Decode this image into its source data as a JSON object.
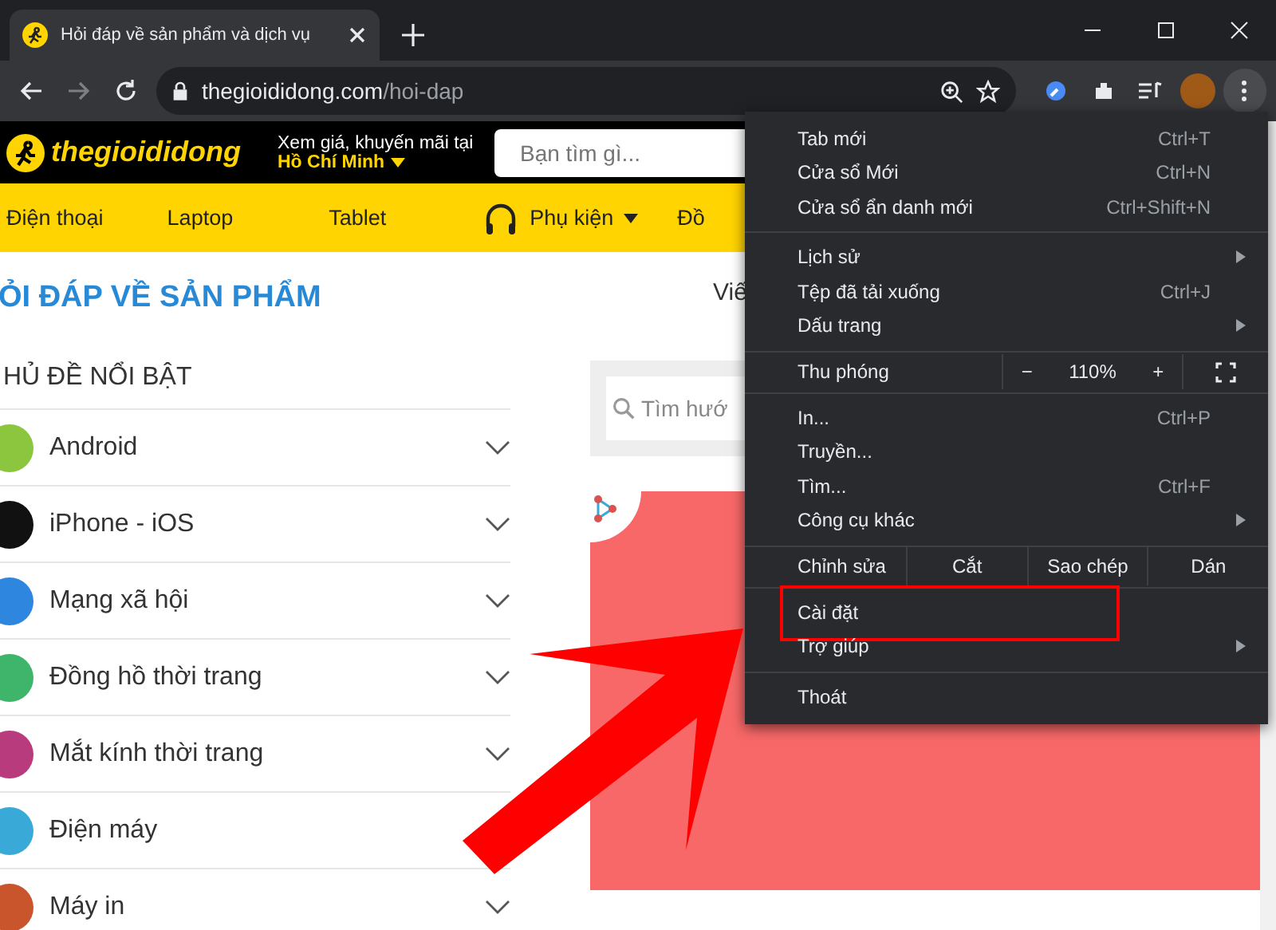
{
  "browser": {
    "tab": {
      "title": "Hỏi đáp về sản phẩm và dịch vụ",
      "selected": true
    },
    "url": {
      "domain": "thegioididong.com",
      "path": "/hoi-dap"
    }
  },
  "site_header": {
    "logo": "thegioididong",
    "location_prompt": "Xem giá, khuyến mãi tại",
    "city": "Hồ Chí Minh",
    "search": {
      "placeholder": "Bạn tìm gì..."
    }
  },
  "nav": [
    {
      "label": "Điện thoại",
      "kind": "plain"
    },
    {
      "label": "Laptop",
      "kind": "plain"
    },
    {
      "label": "Tablet",
      "kind": "plain"
    },
    {
      "label": "Phụ kiện",
      "kind": "dropdown"
    },
    {
      "label": "Đồ",
      "kind": "plain"
    }
  ],
  "page": {
    "title": "ỎI ĐÁP VỀ SẢN PHẨM",
    "title_link": "Viế",
    "section_title": "HỦ ĐỀ NỔI BẬT",
    "search": {
      "placeholder": "Tìm hướ"
    },
    "categories": [
      {
        "label": "Android",
        "color": "#8cc63f",
        "expandable": true
      },
      {
        "label": "iPhone - iOS",
        "color": "#111111",
        "expandable": true
      },
      {
        "label": "Mạng xã hội",
        "color": "#2e86de",
        "expandable": true
      },
      {
        "label": "Đồng hồ thời trang",
        "color": "#3fb56b",
        "expandable": true
      },
      {
        "label": "Mắt kính thời trang",
        "color": "#b83b7e",
        "expandable": true
      },
      {
        "label": "Điện máy",
        "color": "#39a9d8",
        "expandable": false
      },
      {
        "label": "Máy in",
        "color": "#c8552b",
        "expandable": true
      }
    ]
  },
  "menu": {
    "sections": [
      [
        {
          "kind": "item",
          "label": "Tab mới",
          "shortcut": "Ctrl+T",
          "submenu": false,
          "highlighted": false
        },
        {
          "kind": "item",
          "label": "Cửa sổ Mới",
          "shortcut": "Ctrl+N",
          "submenu": false,
          "highlighted": false
        },
        {
          "kind": "item",
          "label": "Cửa sổ ẩn danh mới",
          "shortcut": "Ctrl+Shift+N",
          "submenu": false,
          "highlighted": false
        }
      ],
      [
        {
          "kind": "item",
          "label": "Lịch sử",
          "submenu": true,
          "highlighted": false
        },
        {
          "kind": "item",
          "label": "Tệp đã tải xuống",
          "shortcut": "Ctrl+J",
          "submenu": false,
          "highlighted": false
        },
        {
          "kind": "item",
          "label": "Dấu trang",
          "submenu": true,
          "highlighted": false
        }
      ],
      [
        {
          "kind": "zoom",
          "label": "Thu phóng",
          "minus": "−",
          "value": "110%",
          "plus": "+"
        }
      ],
      [
        {
          "kind": "item",
          "label": "In...",
          "shortcut": "Ctrl+P",
          "submenu": false,
          "highlighted": false
        },
        {
          "kind": "item",
          "label": "Truyền...",
          "submenu": false,
          "highlighted": false
        },
        {
          "kind": "item",
          "label": "Tìm...",
          "shortcut": "Ctrl+F",
          "submenu": false,
          "highlighted": false
        },
        {
          "kind": "item",
          "label": "Công cụ khác",
          "submenu": true,
          "highlighted": false
        }
      ],
      [
        {
          "kind": "edit",
          "label": "Chỉnh sửa",
          "actions": [
            "Cắt",
            "Sao chép",
            "Dán"
          ]
        }
      ],
      [
        {
          "kind": "item",
          "label": "Cài đặt",
          "submenu": false,
          "highlighted": true
        },
        {
          "kind": "item",
          "label": "Trợ giúp",
          "submenu": true,
          "highlighted": false
        }
      ],
      [
        {
          "kind": "item",
          "label": "Thoát",
          "submenu": false,
          "highlighted": false
        }
      ]
    ]
  }
}
